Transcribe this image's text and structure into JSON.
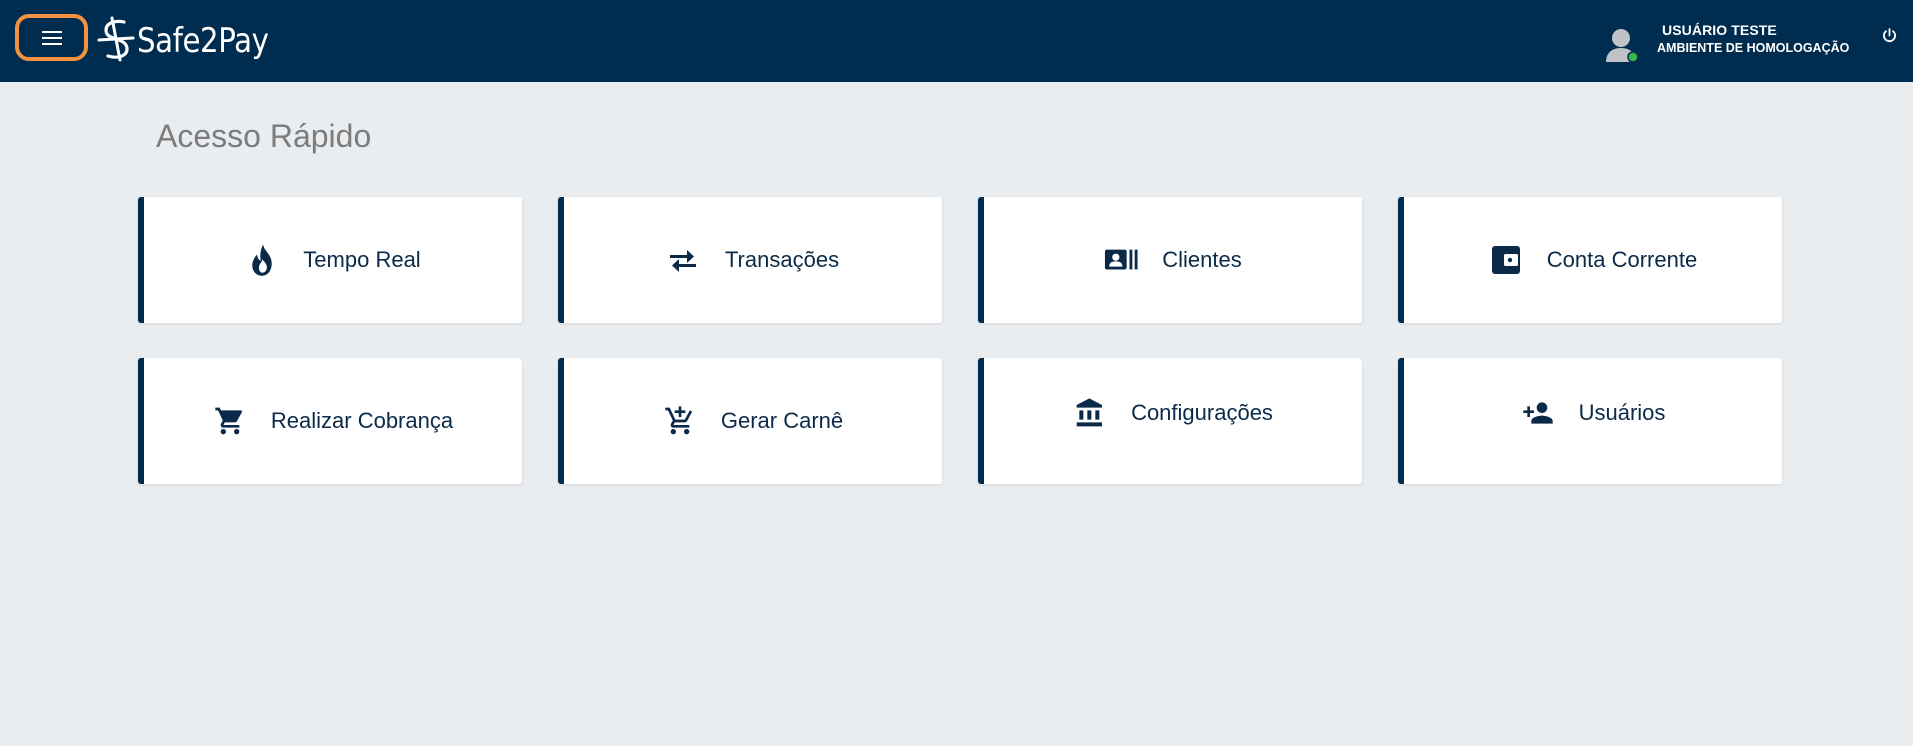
{
  "header": {
    "brand": "Safe2Pay",
    "user_name": "USUÁRIO TESTE",
    "environment": "AMBIENTE DE HOMOLOGAÇÃO",
    "status_color": "#39b54a"
  },
  "main": {
    "title": "Acesso Rápido",
    "cards": [
      {
        "label": "Tempo Real",
        "icon": "flame-icon"
      },
      {
        "label": "Transações",
        "icon": "swap-arrows-icon"
      },
      {
        "label": "Clientes",
        "icon": "contact-card-icon"
      },
      {
        "label": "Conta Corrente",
        "icon": "wallet-icon"
      },
      {
        "label": "Realizar Cobrança",
        "icon": "shopping-cart-icon"
      },
      {
        "label": "Gerar Carnê",
        "icon": "add-cart-icon"
      },
      {
        "label": "Configurações",
        "icon": "bank-icon"
      },
      {
        "label": "Usuários",
        "icon": "add-user-icon"
      }
    ]
  },
  "colors": {
    "header_bg": "#002d4f",
    "accent": "#002d4f",
    "highlight": "#f5923e",
    "page_bg": "#eaedf0"
  }
}
